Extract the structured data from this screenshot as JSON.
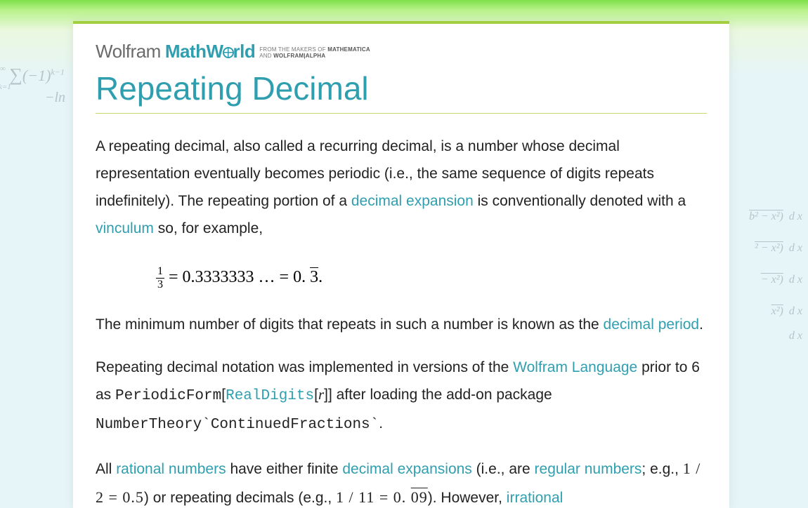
{
  "brand": {
    "wolfram": "Wolfram",
    "mathworld_pre": "MathW",
    "mathworld_post": "rld",
    "sub_line1_a": "FROM THE MAKERS OF ",
    "sub_line1_b": "MATHEMATICA",
    "sub_line2_a": "AND ",
    "sub_line2_b": "WOLFRAM|ALPHA"
  },
  "title": "Repeating Decimal",
  "para1": {
    "t1": "A repeating decimal, also called a recurring decimal, is a number whose decimal representation eventually becomes periodic (i.e., the same sequence of digits repeats indefinitely). The repeating portion of a ",
    "link1": "decimal expansion",
    "t2": " is conventionally denoted with a ",
    "link2": "vinculum",
    "t3": " so, for example,"
  },
  "equation": {
    "frac_n": "1",
    "frac_d": "3",
    "eq1": " = 0.3333333 … = 0. ",
    "overline": "3",
    "eq_end": "."
  },
  "para2": {
    "t1": "The minimum number of digits that repeats in such a number is known as the ",
    "link1": "decimal period",
    "t2": "."
  },
  "para3": {
    "t1": "Repeating decimal notation was implemented in versions of the ",
    "link1": "Wolfram Language",
    "t2": " prior to 6 as ",
    "code1": "PeriodicForm",
    "t3": "[",
    "link2": "RealDigits",
    "t4": "[",
    "ital": "r",
    "t5": "]] after loading the add-on package ",
    "code2": "NumberTheory`ContinuedFractions`",
    "t6": "."
  },
  "para4": {
    "t1": "All ",
    "link1": "rational numbers",
    "t2": " have either finite ",
    "link2": "decimal expansions",
    "t3": " (i.e., are ",
    "link3": "regular numbers",
    "t4": "; e.g., ",
    "math1": "1 / 2 = 0.5",
    "t5": ") or repeating decimals (e.g., ",
    "math2a": "1 / 11 = 0. ",
    "math2_over": "09",
    "t6": "). However, ",
    "link4": "irrational"
  },
  "bg": {
    "l1": "∑(−1)^{k−1}",
    "l1sub": "k=1",
    "l1sup": "∞",
    "l2": "−ln",
    "r1": "b² − x²)  d x",
    "r2": "² − x²)  d x",
    "r3": "− x²)  d x",
    "r4": "x²)  d x",
    "r5": "d x"
  }
}
